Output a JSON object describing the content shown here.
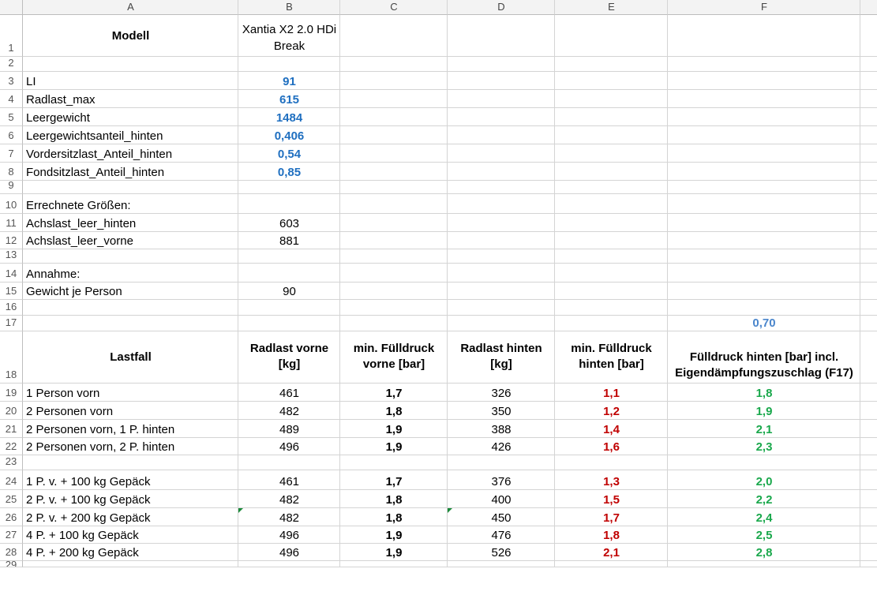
{
  "columns": [
    "A",
    "B",
    "C",
    "D",
    "E",
    "F"
  ],
  "rows": [
    "1",
    "2",
    "3",
    "4",
    "5",
    "6",
    "7",
    "8",
    "9",
    "10",
    "11",
    "12",
    "13",
    "14",
    "15",
    "16",
    "17",
    "18",
    "19",
    "20",
    "21",
    "22",
    "23",
    "24",
    "25",
    "26",
    "27",
    "28",
    "29"
  ],
  "top": {
    "model_label": "Modell",
    "model_name": "Xantia X2 2.0 HDi Break",
    "params": [
      {
        "label": "LI",
        "value": "91"
      },
      {
        "label": "Radlast_max",
        "value": "615"
      },
      {
        "label": "Leergewicht",
        "value": "1484"
      },
      {
        "label": "Leergewichtsanteil_hinten",
        "value": "0,406"
      },
      {
        "label": "Vordersitzlast_Anteil_hinten",
        "value": "0,54"
      },
      {
        "label": "Fondsitzlast_Anteil_hinten",
        "value": "0,85"
      }
    ],
    "computed_title": "Errechnete Größen:",
    "computed": [
      {
        "label": "Achslast_leer_hinten",
        "value": "603"
      },
      {
        "label": "Achslast_leer_vorne",
        "value": "881"
      }
    ],
    "assumption_title": "Annahme:",
    "assumption": {
      "label": "Gewicht je Person",
      "value": "90"
    },
    "f17": "0,70"
  },
  "table": {
    "headers": [
      "Lastfall",
      "Radlast vorne [kg]",
      "min. Fülldruck vorne [bar]",
      "Radlast hinten [kg]",
      "min. Fülldruck hinten [bar]",
      "Fülldruck hinten [bar] incl. Eigendämpfungszuschlag (F17)"
    ],
    "group1": [
      [
        "1 Person vorn",
        "461",
        "1,7",
        "326",
        "1,1",
        "1,8"
      ],
      [
        "2 Personen vorn",
        "482",
        "1,8",
        "350",
        "1,2",
        "1,9"
      ],
      [
        "2 Personen vorn, 1 P. hinten",
        "489",
        "1,9",
        "388",
        "1,4",
        "2,1"
      ],
      [
        "2 Personen vorn, 2 P. hinten",
        "496",
        "1,9",
        "426",
        "1,6",
        "2,3"
      ]
    ],
    "group2": [
      [
        "1 P. v. + 100 kg Gepäck",
        "461",
        "1,7",
        "376",
        "1,3",
        "2,0"
      ],
      [
        "2 P. v. + 100 kg Gepäck",
        "482",
        "1,8",
        "400",
        "1,5",
        "2,2"
      ],
      [
        "2 P. v. + 200 kg Gepäck",
        "482",
        "1,8",
        "450",
        "1,7",
        "2,4"
      ],
      [
        "4 P. + 100 kg Gepäck",
        "496",
        "1,9",
        "476",
        "1,8",
        "2,5"
      ],
      [
        "4 P. + 200 kg Gepäck",
        "496",
        "1,9",
        "526",
        "2,1",
        "2,8"
      ]
    ]
  }
}
